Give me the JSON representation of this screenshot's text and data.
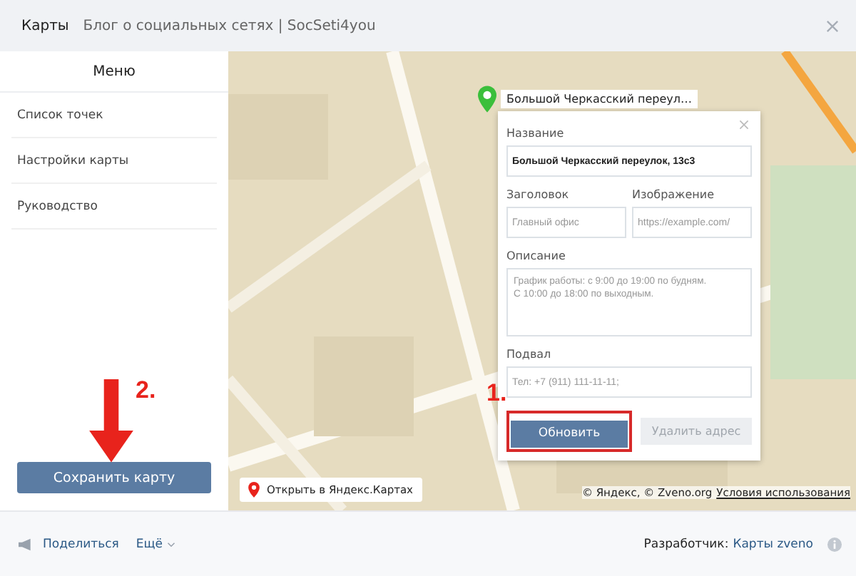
{
  "window": {
    "title": "Карты",
    "subtitle": "Блог о социальных сетях | SocSeti4you"
  },
  "sidebar": {
    "title": "Меню",
    "items": [
      "Список точек",
      "Настройки карты",
      "Руководство"
    ],
    "save_button": "Сохранить карту",
    "annotation": "2."
  },
  "map": {
    "pin_label": "Большой Черкасский переул…",
    "open_link": "Открыть в Яндекс.Картах",
    "copyright": "© Яндекс, © Zveno.org",
    "terms_link": "Условия использования"
  },
  "popup": {
    "fields": [
      {
        "label": "Название",
        "value": "Большой Черкасский переулок, 13с3",
        "kind": "input"
      },
      {
        "label": "Заголовок",
        "placeholder": "Главный офис",
        "kind": "half"
      },
      {
        "label": "Изображение",
        "placeholder": "https://example.com/",
        "kind": "half"
      },
      {
        "label": "Описание",
        "placeholder": "График работы: с 9:00 до 19:00 по будням.\nС 10:00 до 18:00 по выходным.",
        "kind": "textarea"
      },
      {
        "label": "Подвал",
        "placeholder": "Тел: +7 (911) 111-11-11;",
        "kind": "input"
      }
    ],
    "update_button": "Обновить",
    "delete_button": "Удалить адрес",
    "annotation": "1."
  },
  "footer": {
    "share": "Поделиться",
    "more": "Ещё",
    "developer_label": "Разработчик:",
    "developer_link": "Карты zveno"
  }
}
